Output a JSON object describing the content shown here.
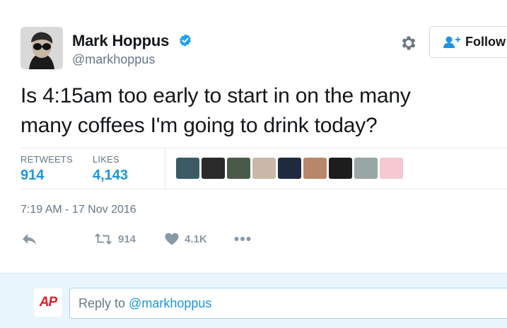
{
  "author": {
    "name": "Mark Hoppus",
    "handle": "@markhoppus",
    "verified": true
  },
  "header": {
    "follow_label": "Follow"
  },
  "tweet": {
    "text_line1": "Is 4:15am too early to start in on the many",
    "text_line2": "many coffees I'm going to drink today?",
    "timestamp": "7:19 AM - 17 Nov 2016"
  },
  "stats": {
    "retweets_label": "RETWEETS",
    "retweets_value": "914",
    "likes_label": "LIKES",
    "likes_value": "4,143"
  },
  "likers": [
    {
      "color": "#3c5a66"
    },
    {
      "color": "#2a2a2a"
    },
    {
      "color": "#4a5a48"
    },
    {
      "color": "#c9b8a8"
    },
    {
      "color": "#1f2b3d"
    },
    {
      "color": "#b8866a"
    },
    {
      "color": "#1d1d1d"
    },
    {
      "color": "#9aa6a6"
    },
    {
      "color": "#f5c8d2"
    }
  ],
  "actions": {
    "retweet_count": "914",
    "like_count": "4.1K"
  },
  "reply": {
    "prefix": "Reply to",
    "mention": "@markhoppus"
  },
  "viewer": {
    "logo_text": "AP"
  },
  "colors": {
    "accent": "#1b95e0",
    "verified": "#1da1f2",
    "muted": "#657786",
    "reply_bar_bg": "#e8f5fd",
    "ap_red": "#e31b23"
  }
}
